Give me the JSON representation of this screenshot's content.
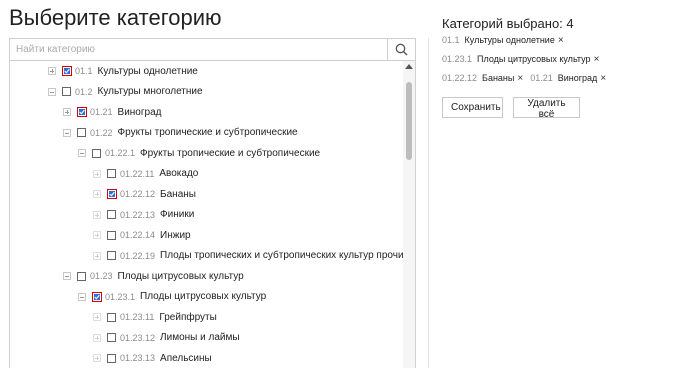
{
  "page": {
    "title": "Выберите категорию"
  },
  "search": {
    "placeholder": "Найти категорию",
    "icon": "search-icon"
  },
  "tree": {
    "rows": [
      {
        "code": "01.1",
        "name": "Культуры однолетние",
        "toggle": "plus",
        "checked": true
      },
      {
        "code": "01.2",
        "name": "Культуры многолетние",
        "toggle": "minus",
        "checked": false
      },
      {
        "code": "01.21",
        "name": "Виноград",
        "toggle": "plus",
        "checked": true
      },
      {
        "code": "01.22",
        "name": "Фрукты тропические и субтропические",
        "toggle": "minus",
        "checked": false
      },
      {
        "code": "01.22.1",
        "name": "Фрукты тропические и субтропические",
        "toggle": "minus",
        "checked": false
      },
      {
        "code": "01.22.11",
        "name": "Авокадо",
        "toggle": "plus",
        "checked": false
      },
      {
        "code": "01.22.12",
        "name": "Бананы",
        "toggle": "plus",
        "checked": true
      },
      {
        "code": "01.22.13",
        "name": "Финики",
        "toggle": "plus",
        "checked": false
      },
      {
        "code": "01.22.14",
        "name": "Инжир",
        "toggle": "plus",
        "checked": false
      },
      {
        "code": "01.22.19",
        "name": "Плоды тропических и субтропических культур прочие",
        "toggle": "plus",
        "checked": false
      },
      {
        "code": "01.23",
        "name": "Плоды цитрусовых культур",
        "toggle": "minus",
        "checked": false
      },
      {
        "code": "01.23.1",
        "name": "Плоды цитрусовых культур",
        "toggle": "minus",
        "checked": true
      },
      {
        "code": "01.23.11",
        "name": "Грейпфруты",
        "toggle": "plus",
        "checked": false
      },
      {
        "code": "01.23.12",
        "name": "Лимоны и лаймы",
        "toggle": "plus",
        "checked": false
      },
      {
        "code": "01.23.13",
        "name": "Апельсины",
        "toggle": "plus",
        "checked": false
      }
    ]
  },
  "selected": {
    "title": "Категорий выбрано: 4",
    "remove_glyph": "×",
    "tags": [
      {
        "code": "01.1",
        "name": "Культуры однолетние"
      },
      {
        "code": "01.23.1",
        "name": "Плоды цитрусовых культур"
      },
      {
        "code": "01.22.12",
        "name": "Бананы"
      },
      {
        "code": "01.21",
        "name": "Виноград"
      }
    ]
  },
  "actions": {
    "save_label": "Сохранить",
    "delete_all_label": "Удалить всё"
  },
  "colors": {
    "checkbox_fill": "#2d6fd9",
    "checkbox_highlight": "#d40000"
  }
}
